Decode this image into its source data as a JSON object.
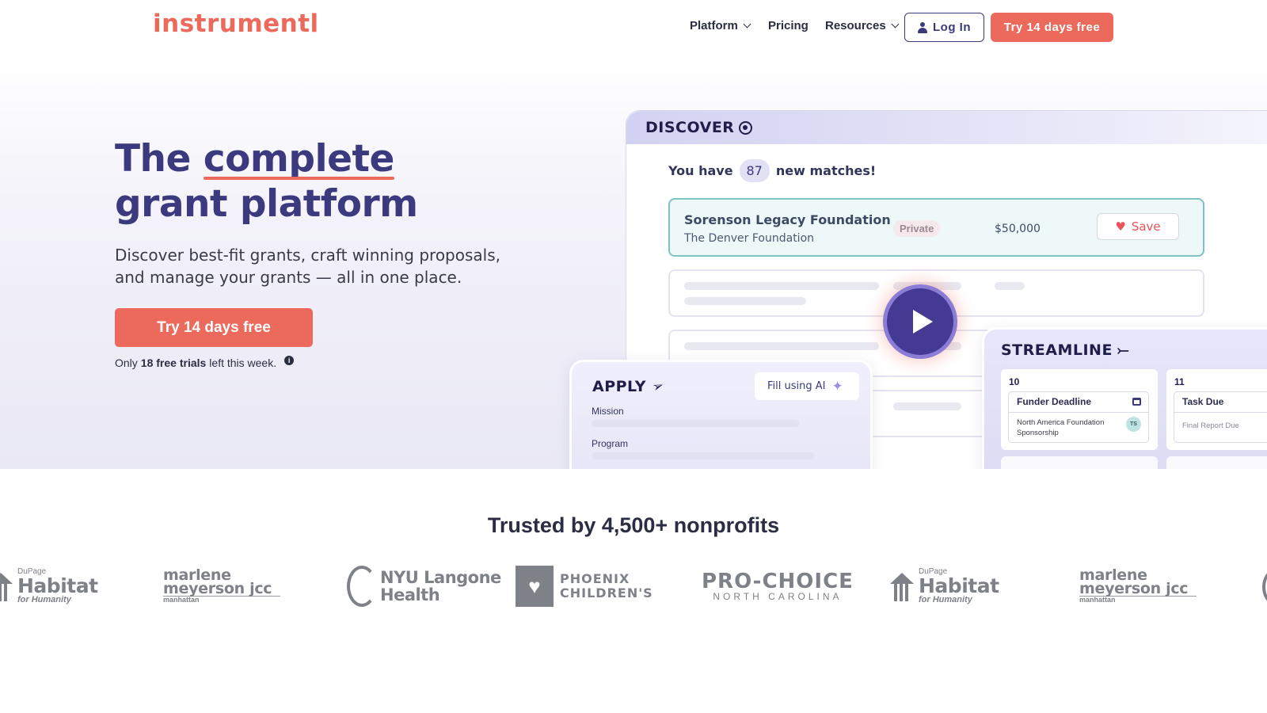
{
  "nav": {
    "logo": "instrumentl",
    "items": [
      {
        "label": "Platform",
        "dropdown": true
      },
      {
        "label": "Pricing",
        "dropdown": false
      },
      {
        "label": "Resources",
        "dropdown": true
      }
    ],
    "login_label": "Log In",
    "cta_label": "Try 14 days free"
  },
  "hero": {
    "title_prefix": "The ",
    "title_highlight": "complete",
    "title_line2": "grant platform",
    "subtitle": "Discover best-fit grants, craft winning proposals, and manage your grants — all in one place.",
    "cta_label": "Try 14 days free",
    "note_prefix": "Only ",
    "note_bold": "18 free trials",
    "note_suffix": " left this week.",
    "info_icon": "i"
  },
  "discover": {
    "label": "DISCOVER",
    "matches_prefix": "You have",
    "matches_count": "87",
    "matches_suffix": "new matches!",
    "grant": {
      "name": "Sorenson Legacy Foundation",
      "funder": "The Denver Foundation",
      "badge": "Private",
      "amount": "$50,000",
      "save_label": "Save"
    }
  },
  "apply": {
    "label": "APPLY",
    "fill_label": "Fill using AI",
    "fields": [
      "Mission",
      "Program"
    ]
  },
  "streamline": {
    "label": "STREAMLINE",
    "days": [
      {
        "num": "10",
        "event_title": "Funder Deadline",
        "event_text": "North America Foundation Sponsorship",
        "avatar": "TS"
      },
      {
        "num": "11",
        "event_title": "Task Due",
        "event_text": "Final Report Due"
      }
    ]
  },
  "trusted": {
    "heading": "Trusted by 4,500+ nonprofits",
    "logos": {
      "habitat": {
        "top": "DuPage",
        "name": "Habitat",
        "sub": "for Humanity"
      },
      "jcc": {
        "line1": "marlene",
        "line2": "meyerson jcc",
        "sub": "manhattan"
      },
      "nyu": {
        "line1": "NYU Langone",
        "line2": "Health"
      },
      "phoenix": {
        "line1": "PHOENIX",
        "line2": "CHILDREN'S"
      },
      "prochoice": {
        "line1": "PRO-CHOICE",
        "line2": "NORTH CAROLINA"
      }
    }
  },
  "colors": {
    "brand": "#ec6a5c",
    "navy": "#3b3a7e",
    "teal": "#7cc3c2"
  },
  "icons": [
    "chevron-down-icon",
    "user-icon",
    "info-icon",
    "target-icon",
    "heart-icon",
    "play-icon",
    "paper-plane-icon",
    "sparkle-icon",
    "arrow-right-icon",
    "calendar-icon"
  ]
}
